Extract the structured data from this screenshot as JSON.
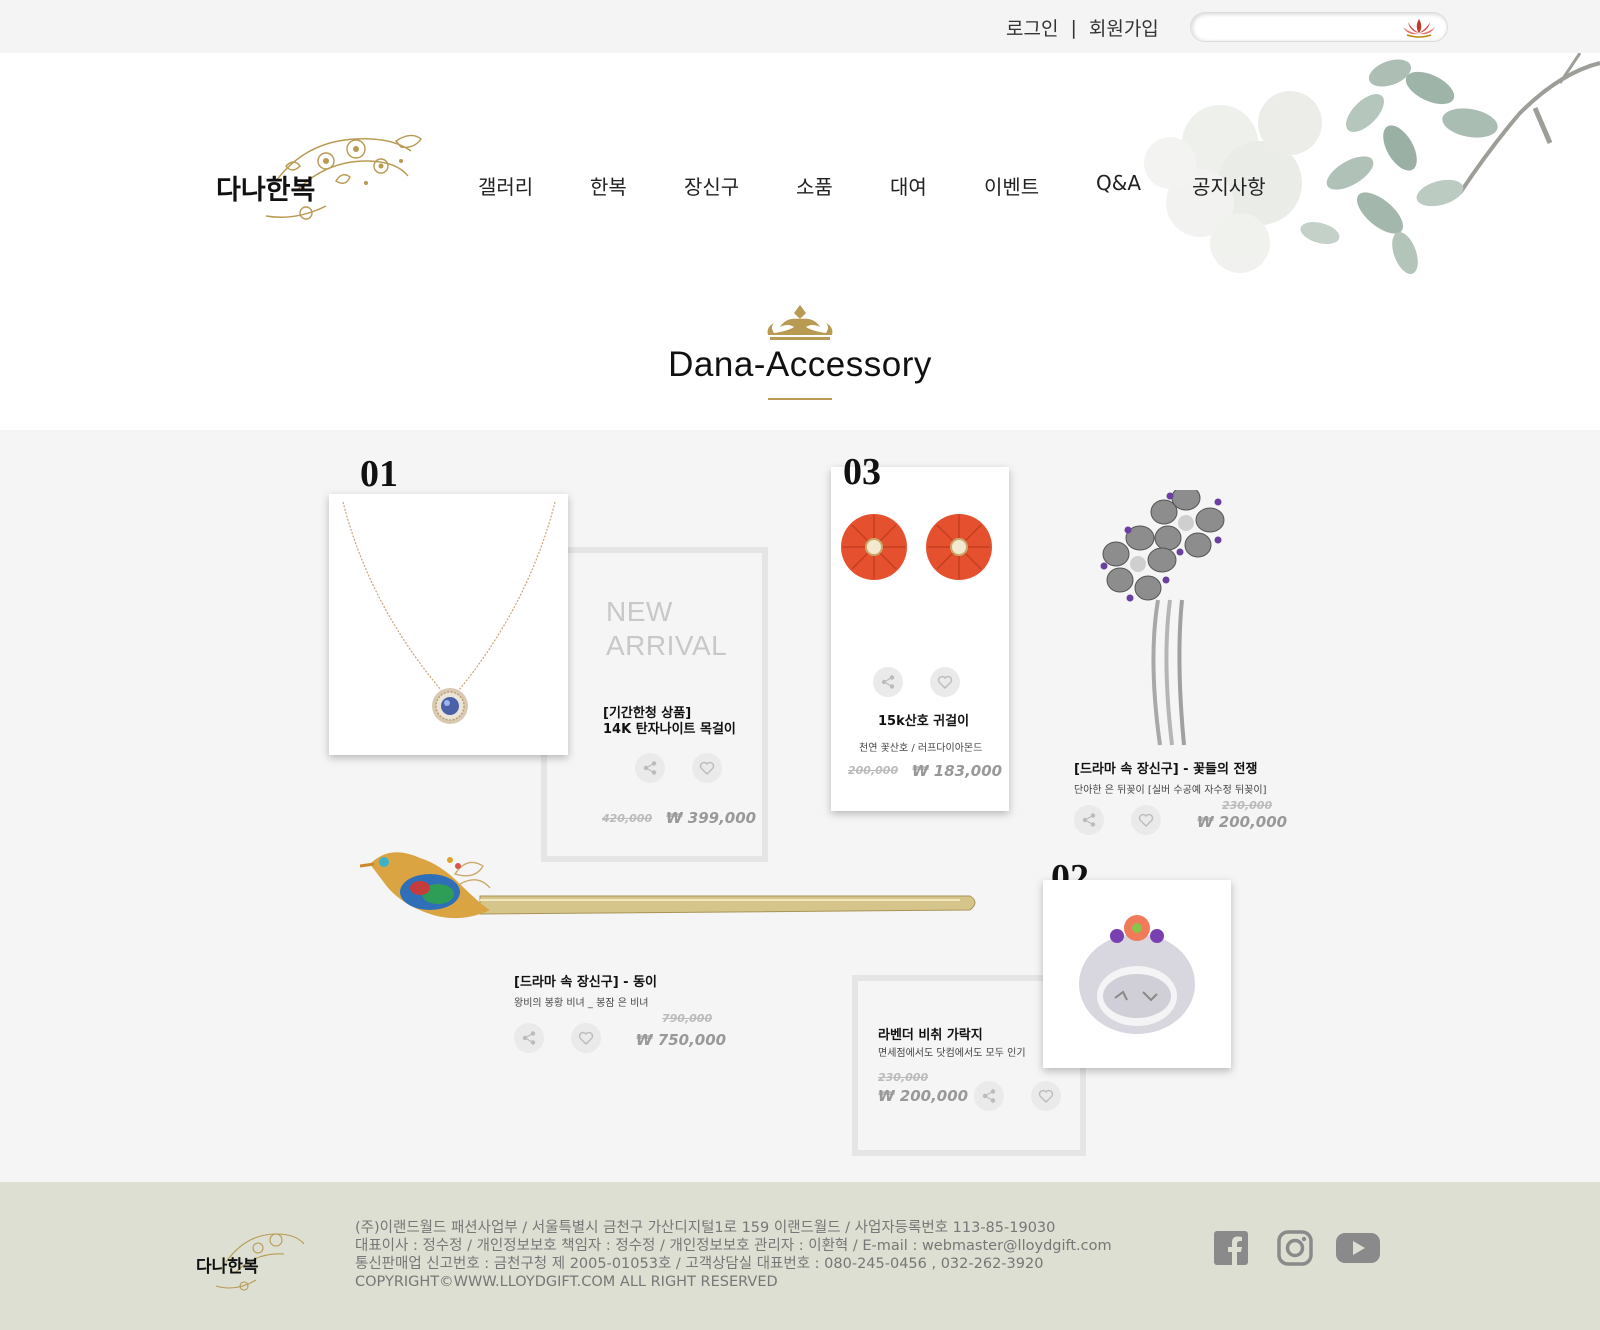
{
  "topbar": {
    "login": "로그인",
    "divider": "|",
    "signup": "회원가입",
    "search_placeholder": ""
  },
  "nav": {
    "items": [
      "갤러리",
      "한복",
      "장신구",
      "소품",
      "대여",
      "이벤트",
      "Q&A",
      "공지사항"
    ]
  },
  "section": {
    "title": "Dana-Accessory"
  },
  "products": {
    "p01": {
      "number": "01",
      "badge_line1": "NEW",
      "badge_line2": "ARRIVAL",
      "name_line1": "[기간한청 상품]",
      "name_line2": "14K 탄자나이트 목걸이",
      "old_price": "420,000",
      "price": "₩ 399,000"
    },
    "p03": {
      "number": "03",
      "name": "15k산호 귀걸이",
      "desc": "천연 꽃산호 / 러프다이아몬드",
      "old_price": "200,000",
      "price": "₩ 183,000"
    },
    "hairpin_flower": {
      "name": "[드라마 속 장신구] - 꽃들의 전쟁",
      "desc": "단아한 은 뒤꽂이 [실버 수공예 자수정 뒤꽂이]",
      "old_price": "230,000",
      "price": "₩ 200,000"
    },
    "phoenix": {
      "name": "[드라마 속 장신구] - 동이",
      "desc": "왕비의 봉황 비녀 _ 봉잠 은 비녀",
      "old_price": "790,000",
      "price": "₩ 750,000"
    },
    "p02": {
      "number": "02",
      "name": "라벤더 비취 가락지",
      "desc": "면세점에서도 닷컴에서도 모두 인기",
      "old_price": "230,000",
      "price": "₩ 200,000"
    }
  },
  "footer": {
    "line1": "(주)이랜드월드 패션사업부 / 서울특별시 금천구 가산디지털1로 159 이랜드월드 / 사업자등록번호 113-85-19030",
    "line2": "대표이사 : 정수정 / 개인정보보호 책임자 : 정수정 / 개인정보보호 관리자 : 이환혁 / E-mail : webmaster@lloydgift.com",
    "line3": "통신판매업 신고번호 : 금천구청 제 2005-01053호 / 고객상담실 대표번호 : 080-245-0456 , 032-262-3920",
    "line4": " COPYRIGHT©WWW.LLOYDGIFT.COM ALL RIGHT RESERVED"
  },
  "colors": {
    "gold": "#b89a52",
    "footer_bg": "#dcdfd2",
    "price_grey": "#999999",
    "frame_grey": "#e5e5e5"
  },
  "icons": [
    "lotus-search-icon",
    "share-icon",
    "heart-icon",
    "facebook-icon",
    "instagram-icon",
    "youtube-icon"
  ]
}
